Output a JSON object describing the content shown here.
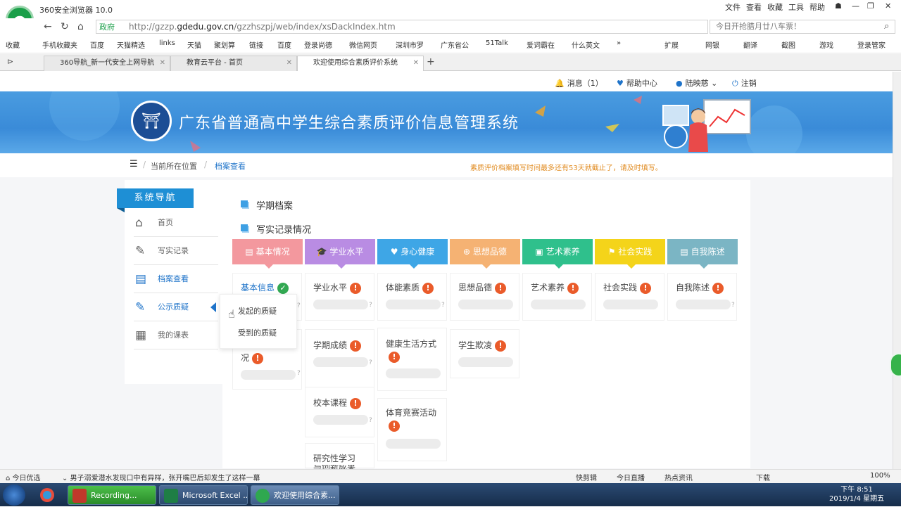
{
  "browser": {
    "app_title": "360安全浏览器 10.0",
    "menu": [
      "文件",
      "查看",
      "收藏",
      "工具",
      "帮助"
    ],
    "address": {
      "badge": "政府",
      "url_prefix": "http://gzzp.",
      "url_domain": "gdedu.gov.cn",
      "url_path": "/gzzhszpj/web/index/xsDackIndex.htm"
    },
    "search_placeholder": "今日开抢腊月廿八车票！",
    "bookmarks": [
      "收藏",
      "手机收藏夹",
      "百度",
      "天猫精选",
      "links",
      "天猫",
      "聚划算",
      "链接",
      "百度",
      "登录尚德",
      "微信网页",
      "深圳市罗",
      "广东省公",
      "51Talk",
      "爱词霸在",
      "什么英文"
    ],
    "bookmarks_right": [
      "扩展",
      "网银",
      "翻译",
      "截图",
      "游戏",
      "登录管家"
    ],
    "tabs": [
      {
        "label": "360导航_新一代安全上网导航",
        "active": false
      },
      {
        "label": "教育云平台 - 首页",
        "active": false
      },
      {
        "label": "欢迎使用综合素质评价系统",
        "active": true
      }
    ]
  },
  "userbar": {
    "messages": "消息（1）",
    "help": "帮助中心",
    "user": "陆映慈",
    "logout": "注销"
  },
  "banner": {
    "title": "广东省普通高中学生综合素质评价信息管理系统"
  },
  "breadcrumb": {
    "current_label": "当前所在位置",
    "page": "档案查看",
    "notice": "素质评价档案填写时间最多还有53天就截止了，请及时填写。"
  },
  "sidebar": {
    "header": "系统导航",
    "items": [
      {
        "label": "首页",
        "icon": "home-icon"
      },
      {
        "label": "写实记录",
        "icon": "edit-icon"
      },
      {
        "label": "档案查看",
        "icon": "archive-icon"
      },
      {
        "label": "公示质疑",
        "icon": "notice-icon"
      },
      {
        "label": "我的课表",
        "icon": "schedule-icon"
      }
    ],
    "popup": [
      "发起的质疑",
      "受到的质疑"
    ]
  },
  "main": {
    "section1": "学期档案",
    "section2": "写实记录情况",
    "categories": [
      {
        "label": "基本情况",
        "color": "#f3989e"
      },
      {
        "label": "学业水平",
        "color": "#b98ce3"
      },
      {
        "label": "身心健康",
        "color": "#3ea6e6"
      },
      {
        "label": "思想品德",
        "color": "#f5b273"
      },
      {
        "label": "艺术素养",
        "color": "#2fc08c"
      },
      {
        "label": "社会实践",
        "color": "#f4d41a"
      },
      {
        "label": "自我陈述",
        "color": "#7bb5c4"
      }
    ],
    "cards": {
      "c0": [
        "基本信息",
        "况"
      ],
      "c1": [
        "学业水平",
        "学期成绩",
        "校本课程",
        "研究性学习"
      ],
      "c2": [
        "体能素质",
        "健康生活方式",
        "体育竞赛活动"
      ],
      "c3": [
        "思想品德",
        "学生欺凌"
      ],
      "c4": [
        "艺术素养"
      ],
      "c5": [
        "社会实践"
      ],
      "c6": [
        "自我陈述"
      ]
    },
    "truncated_tail": "与创新成果"
  },
  "statusbar": {
    "left": "今日优选",
    "news": "男子溺爱潜水发现口中有异样，张开嘴巴后却发生了这样一幕",
    "right": [
      "快剪辑",
      "今日直播",
      "热点资讯",
      "下载",
      "100%"
    ]
  },
  "taskbar": {
    "tasks": [
      "Recording...",
      "Microsoft Excel ...",
      "欢迎使用综合素..."
    ],
    "time": "下午 8:51",
    "date": "2019/1/4 星期五"
  }
}
